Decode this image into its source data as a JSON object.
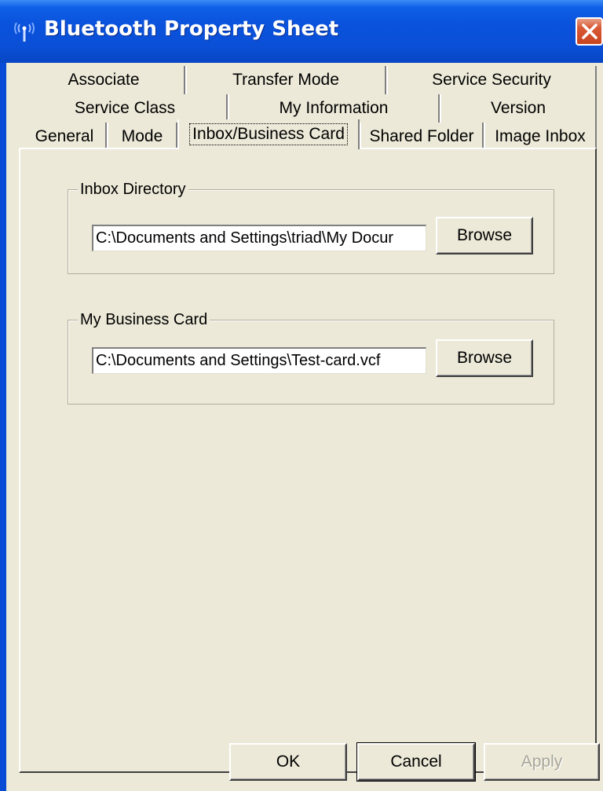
{
  "window": {
    "title": "Bluetooth Property Sheet",
    "icon": "bluetooth-antenna-icon",
    "close_icon": "close-icon"
  },
  "tabs": {
    "row1": [
      "Associate",
      "Transfer Mode",
      "Service Security"
    ],
    "row2": [
      "Service Class",
      "My Information",
      "Version"
    ],
    "row3": [
      "General",
      "Mode",
      "Inbox/Business Card",
      "Shared Folder",
      "Image Inbox"
    ],
    "active": "Inbox/Business Card"
  },
  "inbox": {
    "label": "Inbox Directory",
    "path": "C:\\Documents and Settings\\triad\\My Docur",
    "browse_label": "Browse"
  },
  "business_card": {
    "label": "My Business Card",
    "path": "C:\\Documents and Settings\\Test-card.vcf",
    "browse_label": "Browse"
  },
  "footer": {
    "ok_label": "OK",
    "cancel_label": "Cancel",
    "apply_label": "Apply"
  },
  "colors": {
    "titlebar": "#0a4fd6",
    "face": "#ece9d8",
    "close": "#d95a35"
  }
}
